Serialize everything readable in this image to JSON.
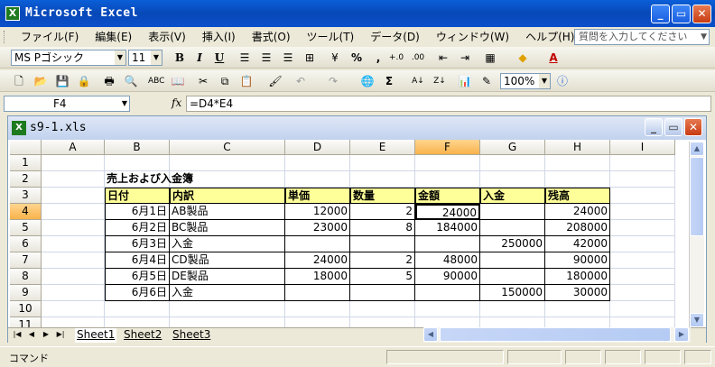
{
  "app": {
    "title": "Microsoft Excel",
    "icon": "excel-app-icon"
  },
  "menus": [
    "ファイル(F)",
    "編集(E)",
    "表示(V)",
    "挿入(I)",
    "書式(O)",
    "ツール(T)",
    "データ(D)",
    "ウィンドウ(W)",
    "ヘルプ(H)"
  ],
  "help": {
    "placeholder": "質問を入力してください"
  },
  "format_toolbar": {
    "font": "MS Pゴシック",
    "size": "11"
  },
  "standard_toolbar": {
    "zoom": "100%"
  },
  "formula_bar": {
    "name_box": "F4",
    "fx": "fx",
    "formula": "=D4*E4"
  },
  "workbook": {
    "title": "s9-1.xls"
  },
  "columns": [
    "A",
    "B",
    "C",
    "D",
    "E",
    "F",
    "G",
    "H",
    "I"
  ],
  "rows": [
    "1",
    "2",
    "3",
    "4",
    "5",
    "6",
    "7",
    "8",
    "9",
    "10",
    "11"
  ],
  "sheet": {
    "title": "売上および入金簿",
    "headers": [
      "日付",
      "内訳",
      "単価",
      "数量",
      "金額",
      "入金",
      "残高"
    ],
    "data": [
      [
        "6月1日",
        "AB製品",
        "12000",
        "2",
        "24000",
        "",
        "24000"
      ],
      [
        "6月2日",
        "BC製品",
        "23000",
        "8",
        "184000",
        "",
        "208000"
      ],
      [
        "6月3日",
        "入金",
        "",
        "",
        "",
        "250000",
        "42000"
      ],
      [
        "6月4日",
        "CD製品",
        "24000",
        "2",
        "48000",
        "",
        "90000"
      ],
      [
        "6月5日",
        "DE製品",
        "18000",
        "5",
        "90000",
        "",
        "180000"
      ],
      [
        "6月6日",
        "入金",
        "",
        "",
        "",
        "150000",
        "30000"
      ]
    ]
  },
  "tabs": [
    "Sheet1",
    "Sheet2",
    "Sheet3"
  ],
  "status": {
    "text": "コマンド"
  },
  "colors": {
    "title_bar": "#0a54d0",
    "header_fill": "#ffff99",
    "selected_header": "#f8b34a"
  }
}
